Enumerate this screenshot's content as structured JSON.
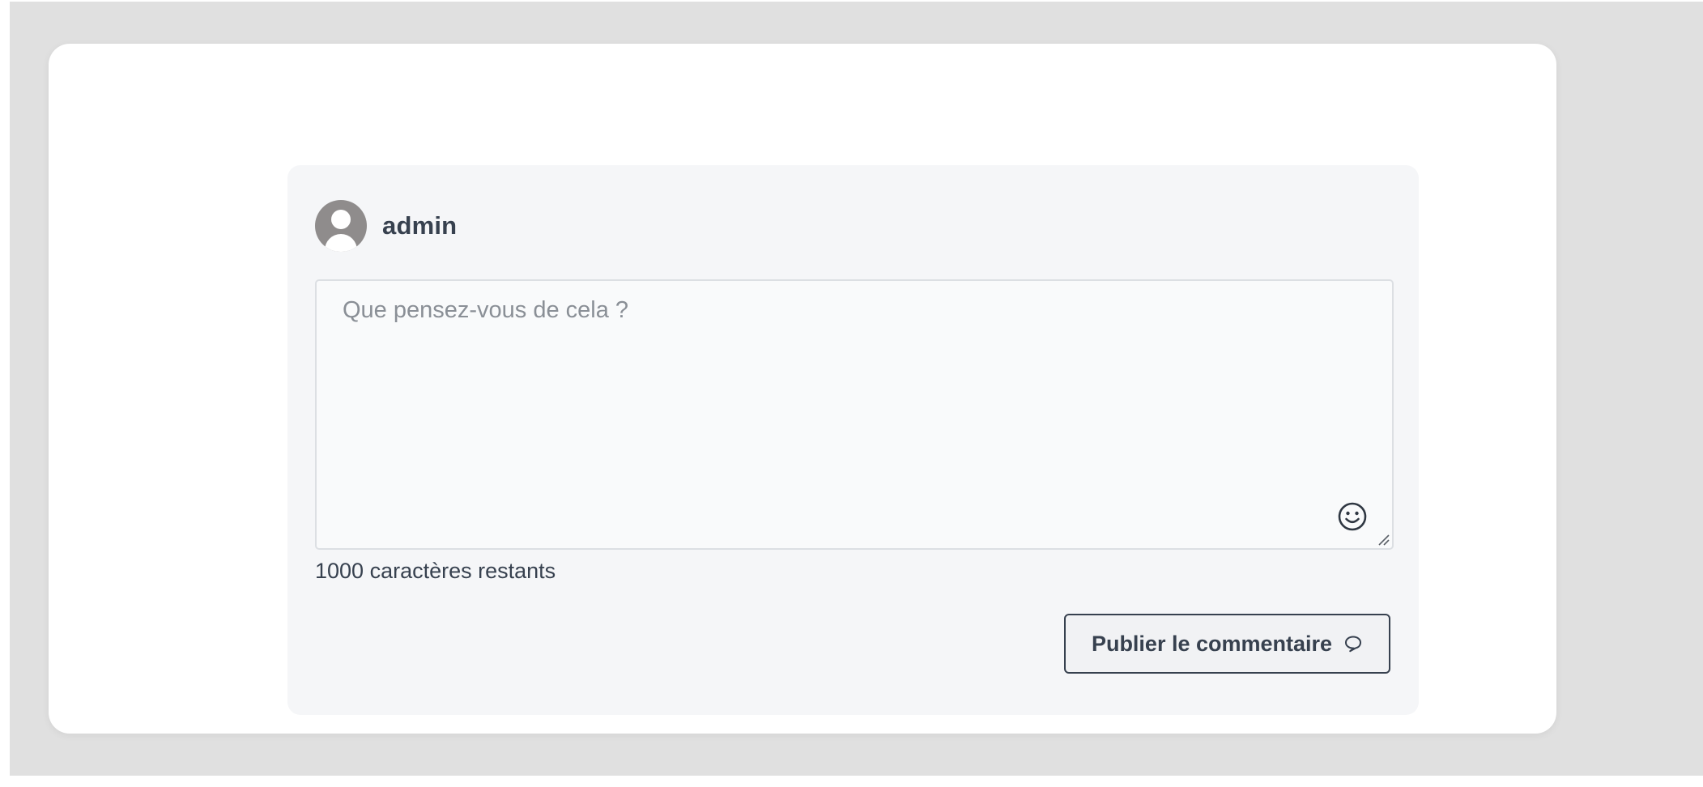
{
  "user": {
    "name": "admin"
  },
  "comment": {
    "placeholder": "Que pensez-vous de cela ?",
    "value": "",
    "chars_remaining": "1000 caractères restants",
    "emoji_icon": "smiley-icon"
  },
  "actions": {
    "publish_label": "Publier le commentaire",
    "publish_icon": "speech-bubble-icon"
  },
  "colors": {
    "text": "#37414f",
    "placeholder": "#8a8f96",
    "panel_background": "#f5f6f8",
    "page_backdrop": "#e0e0e0",
    "avatar": "#8f8c8c"
  }
}
